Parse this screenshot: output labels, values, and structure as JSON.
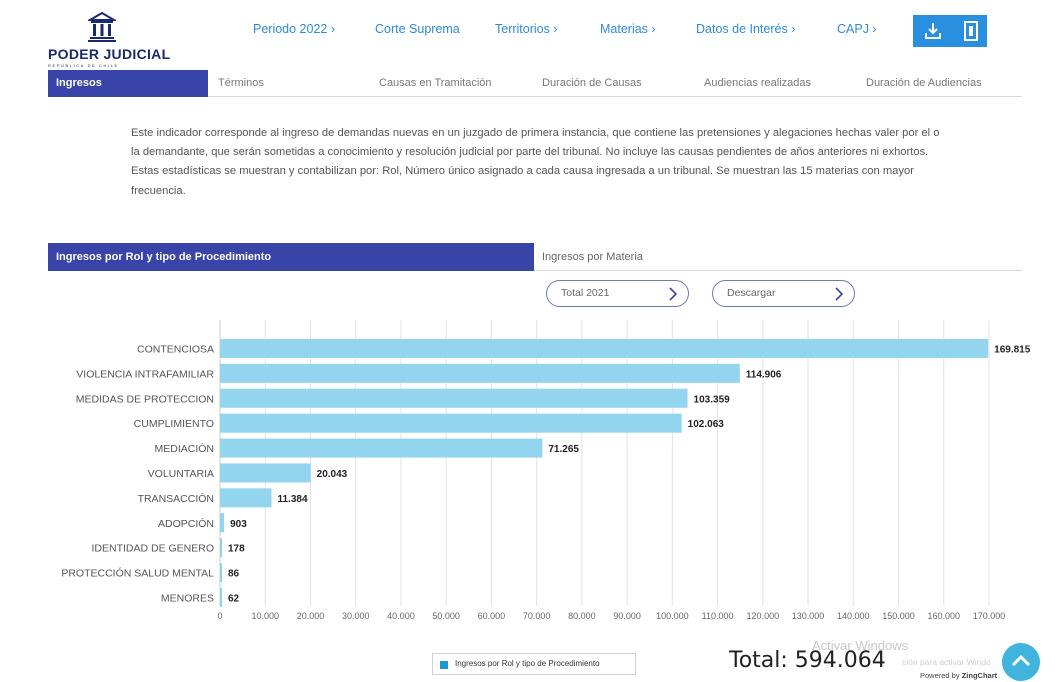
{
  "header": {
    "logo_title": "PODER JUDICIAL",
    "logo_subtitle": "REPÚBLICA DE CHILE",
    "nav": [
      "Periodo 2022 ›",
      "Corte Suprema",
      "Territorios ›",
      "Materias ›",
      "Datos de Interés ›",
      "CAPJ ›"
    ],
    "download_icon": "download-icon",
    "sheet_icon": "spreadsheet-icon",
    "button_color": "#2b8fdf"
  },
  "tabs": [
    "Ingresos",
    "Términos",
    "Causas en Tramitación",
    "Duración de Causas",
    "Audiencias realizadas",
    "Duración de Audiencias"
  ],
  "description": "Este indicador corresponde al ingreso de demandas nuevas en un juzgado de primera instancia, que contiene las pretensiones y alegaciones hechas valer por el o la demandante, que serán sometidas a conocimiento y resolución judicial por parte del tribunal. No incluye las causas pendientes de años anteriores ni exhortos. Estas estadísticas se muestran y contabilizan por: Rol, Número único asignado a cada causa ingresada a un tribunal. Se muestran las 15 materias con mayor frecuencia.",
  "subtabs": {
    "active": "Ingresos por Rol y tipo de Procedimiento",
    "other": "Ingresos por Materia"
  },
  "controls": {
    "period_select": "Total 2021",
    "download_label": "Descargar"
  },
  "chart_data": {
    "type": "bar",
    "orientation": "horizontal",
    "categories": [
      "CONTENCIOSA",
      "VIOLENCIA INTRAFAMILIAR",
      "MEDIDAS DE PROTECCION",
      "CUMPLIMIENTO",
      "MEDIACIÓN",
      "VOLUNTARIA",
      "TRANSACCIÓN",
      "ADOPCIÓN",
      "IDENTIDAD DE GENERO",
      "PROTECCIÓN SALUD MENTAL",
      "MENORES"
    ],
    "values": [
      169815,
      114906,
      103359,
      102063,
      71265,
      20043,
      11384,
      903,
      178,
      86,
      62
    ],
    "value_labels": [
      "169.815",
      "114.906",
      "103.359",
      "102.063",
      "71.265",
      "20.043",
      "11.384",
      "903",
      "178",
      "86",
      "62"
    ],
    "series": [
      {
        "name": "Ingresos por Rol y tipo de Procedimiento",
        "values": [
          169815,
          114906,
          103359,
          102063,
          71265,
          20043,
          11384,
          903,
          178,
          86,
          62
        ]
      }
    ],
    "xlim": [
      0,
      170000
    ],
    "x_ticks": [
      0,
      10000,
      20000,
      30000,
      40000,
      50000,
      60000,
      70000,
      80000,
      90000,
      100000,
      110000,
      120000,
      130000,
      140000,
      150000,
      160000,
      170000
    ],
    "x_tick_labels": [
      "0",
      "10.000",
      "20.000",
      "30.000",
      "40.000",
      "50.000",
      "60.000",
      "70.000",
      "80.000",
      "90.000",
      "100.000",
      "110.000",
      "120.000",
      "130.000",
      "140.000",
      "150.000",
      "160.000",
      "170.000"
    ],
    "grid": "vertical",
    "legend": "bottom",
    "bar_color": "#93d4ee",
    "legend_color": "#1e97d2"
  },
  "total_label": "Total: 594.064",
  "watermark": {
    "line1": "Activar Windows",
    "line2": "ción para activar Windo"
  },
  "powered_by": {
    "prefix": "Powered by ",
    "brand": "ZingChart"
  },
  "fab_icon": "chevron-up-icon"
}
